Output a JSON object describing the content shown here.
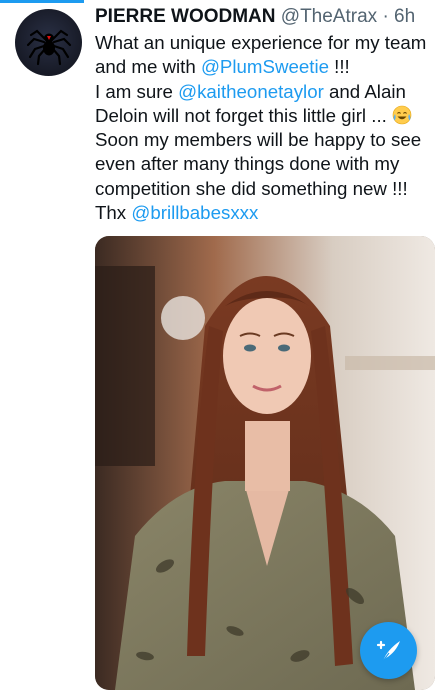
{
  "tweet": {
    "author_name": "PIERRE WOODMAN",
    "handle": "@TheAtrax",
    "separator": "·",
    "time": "6h",
    "lines": [
      {
        "pre": "What an unique experience for my team",
        "mention": "",
        "post": ""
      },
      {
        "pre": "and me with ",
        "mention": "@PlumSweetie",
        "post": " !!!"
      },
      {
        "pre": "I am sure ",
        "mention": "@kaitheonetaylor",
        "post": " and Alain"
      },
      {
        "pre": "Deloin will not forget this little girl ... ",
        "mention": "",
        "post": ""
      },
      {
        "pre": "Soon my members will be happy to see",
        "mention": "",
        "post": ""
      },
      {
        "pre": "even after many things done with my",
        "mention": "",
        "post": ""
      },
      {
        "pre": "competition she did something new !!!",
        "mention": "",
        "post": ""
      },
      {
        "pre": "Thx ",
        "mention": "@brillbabesxxx",
        "post": ""
      }
    ],
    "emoji_icon": "tears-of-joy-emoji-icon"
  },
  "icons": {
    "avatar": "spider-avatar-icon",
    "compose": "compose-tweet-icon"
  },
  "colors": {
    "accent": "#1d9bf0",
    "text_primary": "#0f1419",
    "text_secondary": "#536471"
  }
}
